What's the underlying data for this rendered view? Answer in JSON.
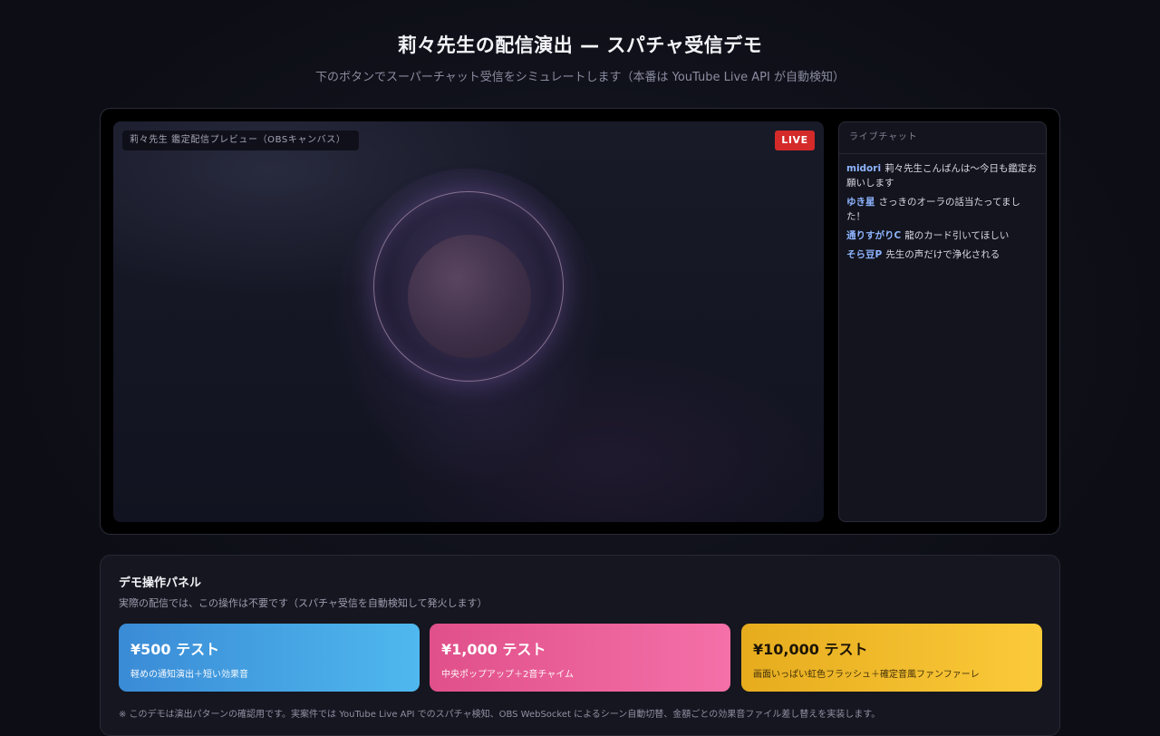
{
  "header": {
    "title": "莉々先生の配信演出 — スパチャ受信デモ",
    "subtitle": "下のボタンでスーパーチャット受信をシミュレートします（本番は YouTube Live API が自動検知）"
  },
  "stage": {
    "canvas_label": "莉々先生 鑑定配信プレビュー（OBSキャンバス）",
    "live_badge": "LIVE"
  },
  "chat": {
    "header": "ライブチャット",
    "messages": [
      {
        "user": "midori",
        "text": "莉々先生こんばんは〜今日も鑑定お願いします"
      },
      {
        "user": "ゆき星",
        "text": "さっきのオーラの話当たってました！"
      },
      {
        "user": "通りすがりC",
        "text": "龍のカード引いてほしい"
      },
      {
        "user": "そら豆P",
        "text": "先生の声だけで浄化される"
      }
    ]
  },
  "panel": {
    "title": "デモ操作パネル",
    "description": "実際の配信では、この操作は不要です（スパチャ受信を自動検知して発火します）",
    "buttons": [
      {
        "title": "¥500 テスト",
        "subtitle": "軽めの通知演出＋短い効果音"
      },
      {
        "title": "¥1,000 テスト",
        "subtitle": "中央ポップアップ＋2音チャイム"
      },
      {
        "title": "¥10,000 テスト",
        "subtitle": "画面いっぱい虹色フラッシュ＋確定音風ファンファーレ"
      }
    ],
    "note_1": "※ このデモは演出パターンの確認用です。実案件では YouTube Live API でのスパチャ検知、OBS WebSocket によるシーン自動切替、金額ごとの効果音ファイル差し替えを実装します。"
  },
  "colors": {
    "live": "#d42a2a",
    "chat_user": "#8eb4ff",
    "btn_500": "#4fb8ee",
    "btn_1000": "#f570a8",
    "btn_10000": "#fbca3a"
  }
}
